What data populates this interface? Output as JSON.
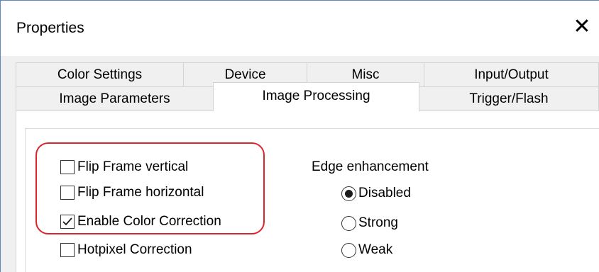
{
  "window": {
    "title": "Properties"
  },
  "tabs": {
    "row1": [
      "Color Settings",
      "Device",
      "Misc",
      "Input/Output"
    ],
    "row2": [
      "Image Parameters",
      "Image Processing",
      "Trigger/Flash"
    ],
    "active": "Image Processing"
  },
  "options": {
    "checkboxes": [
      {
        "label": "Flip Frame vertical",
        "checked": false
      },
      {
        "label": "Flip Frame horizontal",
        "checked": false
      },
      {
        "label": "Enable Color Correction",
        "checked": true
      },
      {
        "label": "Hotpixel Correction",
        "checked": false
      }
    ]
  },
  "edge": {
    "label": "Edge enhancement",
    "options": [
      {
        "label": "Disabled",
        "selected": true
      },
      {
        "label": "Strong",
        "selected": false
      },
      {
        "label": "Weak",
        "selected": false
      }
    ]
  },
  "colors": {
    "highlight": "#d9262c",
    "window_border": "#5a88c8"
  }
}
